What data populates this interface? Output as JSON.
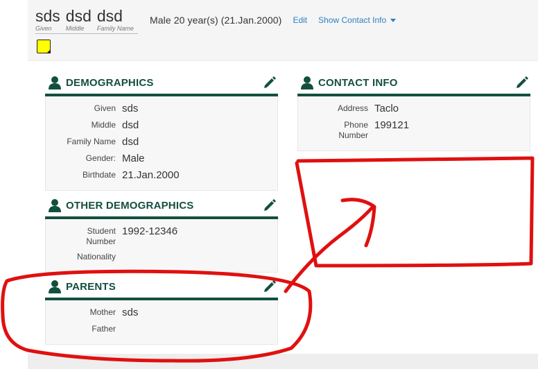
{
  "header": {
    "given": "sds",
    "middle": "dsd",
    "family": "dsd",
    "given_caption": "Given",
    "middle_caption": "Middle",
    "family_caption": "Family Name",
    "sex_age": "Male  20 year(s) (21.Jan.2000)",
    "edit_label": "Edit",
    "contact_label": "Show Contact Info"
  },
  "demographics": {
    "title": "DEMOGRAPHICS",
    "given_label": "Given",
    "given_value": "sds",
    "middle_label": "Middle",
    "middle_value": "dsd",
    "family_label": "Family Name",
    "family_value": "dsd",
    "gender_label": "Gender:",
    "gender_value": "Male",
    "birth_label": "Birthdate",
    "birth_value": "21.Jan.2000"
  },
  "other_demographics": {
    "title": "OTHER DEMOGRAPHICS",
    "student_label_1": "Student",
    "student_label_2": "Number",
    "student_value": "1992-12346",
    "nationality_label": "Nationality",
    "nationality_value": ""
  },
  "parents": {
    "title": "PARENTS",
    "mother_label": "Mother",
    "mother_value": "sds",
    "father_label": "Father",
    "father_value": ""
  },
  "contact": {
    "title": "CONTACT INFO",
    "address_label": "Address",
    "address_value": "Taclo",
    "phone_label_1": "Phone",
    "phone_label_2": "Number",
    "phone_value": "199121"
  },
  "colors": {
    "accent": "#134f3f",
    "link": "#2f7fc1",
    "annotation": "#e01010",
    "note": "#ffff00"
  },
  "icons": [
    "person-icon",
    "pencil-icon",
    "sticky-note-icon",
    "caret-down-icon"
  ]
}
